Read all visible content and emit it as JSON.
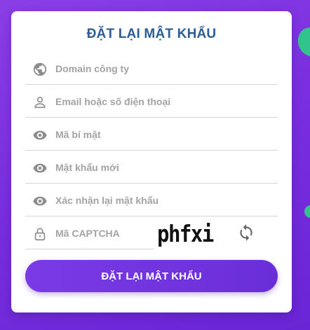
{
  "colors": {
    "background": "#7a2fe0",
    "accent": "#6a2ed8",
    "title": "#2c5d94",
    "decor": "#31c48d"
  },
  "form": {
    "title": "ĐẶT LẠI MẬT KHẨU",
    "fields": [
      {
        "icon": "globe-icon",
        "placeholder": "Domain công ty"
      },
      {
        "icon": "user-icon",
        "placeholder": "Email hoặc số điện thoại"
      },
      {
        "icon": "eye-icon",
        "placeholder": "Mã bí mật"
      },
      {
        "icon": "eye-icon",
        "placeholder": "Mật khẩu mới"
      },
      {
        "icon": "eye-icon",
        "placeholder": "Xác nhận lại mật khẩu"
      }
    ],
    "captcha": {
      "icon": "lock-icon",
      "placeholder": "Mã CAPTCHA",
      "image_text": "phfxi",
      "refresh_icon": "refresh-icon"
    },
    "submit_label": "ĐẶT LẠI MẬT KHẨU"
  }
}
